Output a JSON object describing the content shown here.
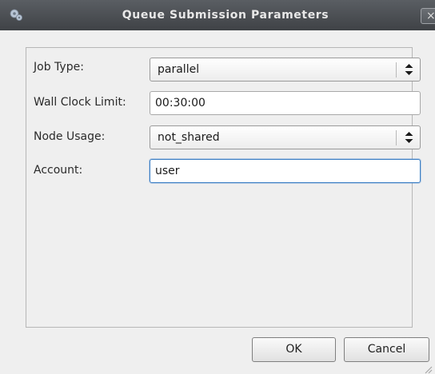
{
  "window": {
    "title": "Queue Submission Parameters",
    "close_label": "×",
    "icon": "gear-icon"
  },
  "form": {
    "job_type": {
      "label": "Job Type:",
      "value": "parallel"
    },
    "wall_clock_limit": {
      "label": "Wall Clock Limit:",
      "value": "00:30:00"
    },
    "node_usage": {
      "label": "Node Usage:",
      "value": "not_shared"
    },
    "account": {
      "label": "Account:",
      "value": "user"
    }
  },
  "buttons": {
    "ok": "OK",
    "cancel": "Cancel"
  },
  "colors": {
    "titlebar": "#4a4d51",
    "window_bg": "#efefef",
    "focus_border": "#3c7fc4"
  }
}
